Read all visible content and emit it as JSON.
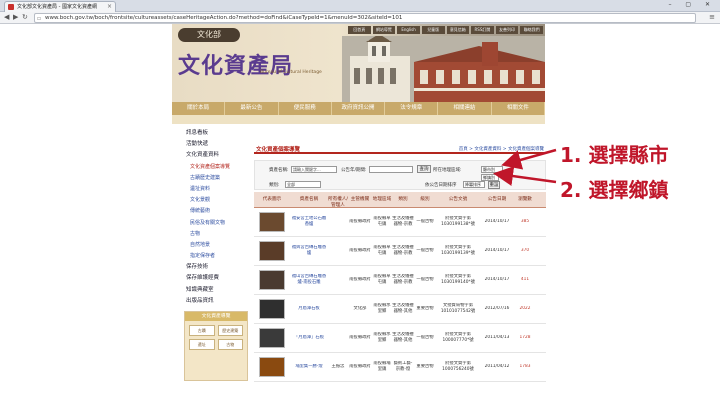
{
  "browser": {
    "tab_title": "文化部文化資產局 - 國家文化資產網",
    "url": "www.boch.gov.tw/boch/frontsite/cultureassets/caseHeritageAction.do?method=doFind&iCaseTypeId=1&menuId=302&siteId=101",
    "window_controls": "– ▢ ✕"
  },
  "header": {
    "logo": "文化部",
    "site_title": "文化資產局",
    "site_subtitle": "Bureau of Cultural Heritage",
    "top_links": [
      "回首頁",
      "網站導覽",
      "English",
      "兒童版",
      "意見信箱",
      "RSS訂閱",
      "友善列印",
      "聯絡我們"
    ],
    "main_nav": [
      "關於本局",
      "最新公告",
      "便民服務",
      "政府資訊公開",
      "法令規章",
      "相關連結",
      "相關文件"
    ]
  },
  "sidebar": {
    "items": [
      {
        "label": "訊息看板",
        "sub": false
      },
      {
        "label": "活動快遞",
        "sub": false
      },
      {
        "label": "文化資產資料",
        "sub": false
      },
      {
        "label": "文化資產個案導覽",
        "sub": true,
        "active": true
      },
      {
        "label": "古蹟歷史建築",
        "sub": true
      },
      {
        "label": "遺址資料",
        "sub": true
      },
      {
        "label": "文化景觀",
        "sub": true
      },
      {
        "label": "傳統藝術",
        "sub": true
      },
      {
        "label": "民俗及有關文物",
        "sub": true
      },
      {
        "label": "古物",
        "sub": true
      },
      {
        "label": "自然地景",
        "sub": true
      },
      {
        "label": "指定保存者",
        "sub": true
      },
      {
        "label": "保存技術",
        "sub": false
      },
      {
        "label": "保存維護經費",
        "sub": false
      },
      {
        "label": "知識典藏室",
        "sub": false
      },
      {
        "label": "出版品資訊",
        "sub": false
      }
    ],
    "box_title": "文化資產導覽",
    "box_cells": [
      "古蹟",
      "歷史建築",
      "遺址",
      "古物"
    ]
  },
  "content": {
    "title": "文化資產個案導覽",
    "breadcrumb": "首頁 > 文化資產資料 > 文化資產個案導覽",
    "search": {
      "keyword_label": "資產名稱:",
      "keyword_placeholder": "請輸入關鍵字...",
      "year_label": "公告年/期間:",
      "query_button": "查詢",
      "county_label": "所在地理區域:",
      "county_value": "縣市別",
      "town_value": "鄉鎮別",
      "category_label": "類別:",
      "category_value": "全部",
      "sort_label": "依公告日期排序",
      "sort_value": "降冪排序",
      "clear_button": "重設"
    },
    "columns": [
      "代表圖示",
      "資產名稱",
      "所有權人/管理人",
      "主管機關",
      "地理區域",
      "類別",
      "級別",
      "公告文號",
      "公告日期",
      "瀏覽數"
    ],
    "rows": [
      {
        "name": "福安宮土地公石雕香爐",
        "owner": "",
        "agency": "南投縣政府",
        "region": "南投縣草屯鎮",
        "type": "生活及儀禮器物-宗教",
        "level": "一般古物",
        "doc": "府授文資字第1030199138*號",
        "date": "2014/10/17",
        "views": "385",
        "thumb": "#6b4a2f"
      },
      {
        "name": "福興宮古磚石雕香爐",
        "owner": "",
        "agency": "南投縣政府",
        "region": "南投縣草屯鎮",
        "type": "生活及儀禮器物-宗教",
        "level": "一般古物",
        "doc": "府授文資字第1030199139*號",
        "date": "2014/10/17",
        "views": "370",
        "thumb": "#5a3c28"
      },
      {
        "name": "福山宮古磚石雕香爐-南投石雕",
        "owner": "",
        "agency": "南投縣政府",
        "region": "南投縣草屯鎮",
        "type": "生活及儀禮器物-宗教",
        "level": "一般古物",
        "doc": "府授文資字第1030199140*號",
        "date": "2014/10/17",
        "views": "411",
        "thumb": "#4a3a30"
      },
      {
        "name": "月眉潭石板",
        "owner": "",
        "agency": "文化部",
        "region": "南投縣水里鄉",
        "type": "生活及儀禮器物-其他",
        "level": "重要古物",
        "doc": "文授資局物字第10101077542號",
        "date": "2012/07/16",
        "views": "2022",
        "thumb": "#2f2f2f"
      },
      {
        "name": "「月眉潭」石板",
        "owner": "",
        "agency": "南投縣政府",
        "region": "南投縣水里鄉",
        "type": "生活及儀禮器物-其他",
        "level": "一般古物",
        "doc": "府授文資字第100007770*號",
        "date": "2011/04/13",
        "views": "1728",
        "thumb": "#3a3a3a"
      },
      {
        "name": "埔里集一勝-燈",
        "owner": "王振忠",
        "agency": "南投縣政府",
        "region": "南投縣埔里鎮",
        "type": "藝術工藝-宗教-燈",
        "level": "重要古物",
        "doc": "府授文資字第1000756240號",
        "date": "2011/04/12",
        "views": "1783",
        "thumb": "#8a4a10"
      }
    ]
  },
  "annotations": {
    "step1": "1. 選擇縣市",
    "step2": "2. 選擇鄉鎮"
  },
  "colors": {
    "accent_red": "#b3261e",
    "annotation_red": "#c0162a",
    "nav_gold": "#c8a96a",
    "title_purple": "#5a3b8f"
  }
}
